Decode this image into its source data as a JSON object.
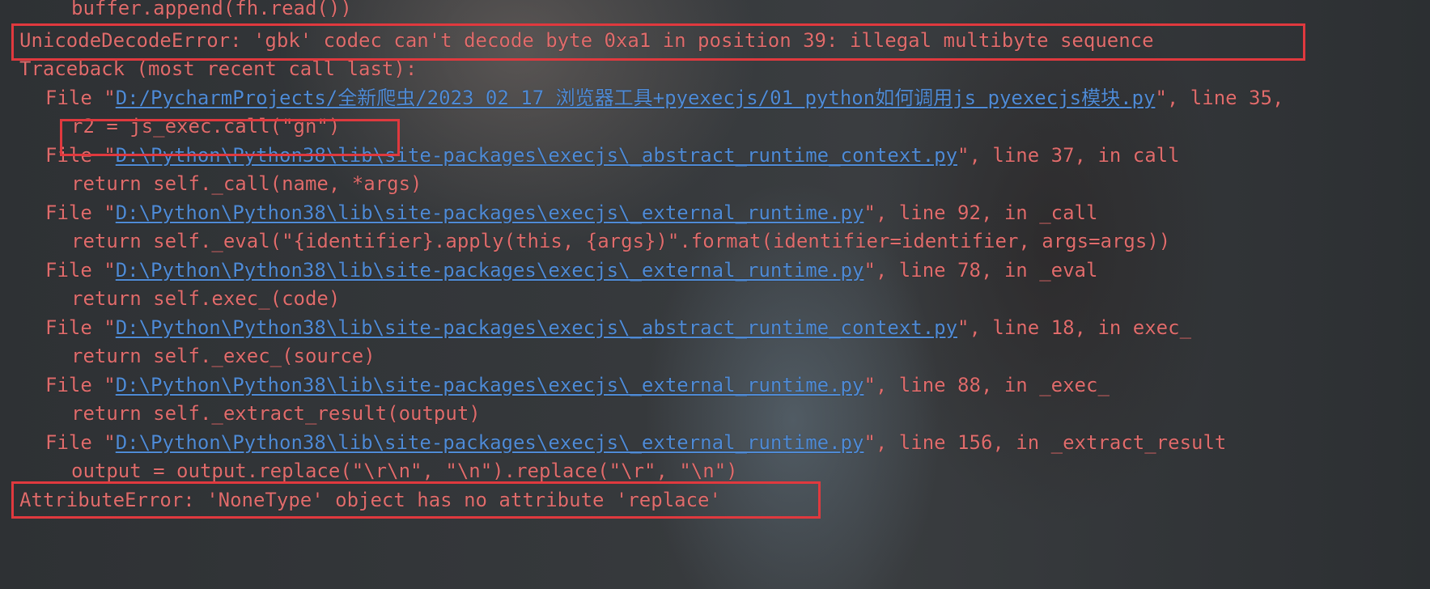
{
  "colors": {
    "error_text": "#e06c6c",
    "link": "#4f8bd6",
    "highlight_box": "#e0393e"
  },
  "lines": [
    {
      "kind": "code",
      "text": "buffer.append(fh.read())"
    },
    {
      "kind": "error",
      "text": "UnicodeDecodeError: 'gbk' codec can't decode byte 0xa1 in position 39: illegal multibyte sequence"
    },
    {
      "kind": "header",
      "text": "Traceback (most recent call last):"
    },
    {
      "kind": "file",
      "prefix": "File \"",
      "path": "D:/PycharmProjects/全新爬虫/2023 02 17 浏览器工具+pyexecjs/01 python如何调用js pyexecjs模块.py",
      "suffix": "\", line 35,"
    },
    {
      "kind": "code",
      "text": "r2 = js_exec.call(\"gn\")"
    },
    {
      "kind": "file",
      "prefix": "File \"",
      "path": "D:\\Python\\Python38\\lib\\site-packages\\execjs\\_abstract_runtime_context.py",
      "suffix": "\", line 37, in call"
    },
    {
      "kind": "code",
      "text": "return self._call(name, *args)"
    },
    {
      "kind": "file",
      "prefix": "File \"",
      "path": "D:\\Python\\Python38\\lib\\site-packages\\execjs\\_external_runtime.py",
      "suffix": "\", line 92, in _call"
    },
    {
      "kind": "code",
      "text": "return self._eval(\"{identifier}.apply(this, {args})\".format(identifier=identifier, args=args))"
    },
    {
      "kind": "file",
      "prefix": "File \"",
      "path": "D:\\Python\\Python38\\lib\\site-packages\\execjs\\_external_runtime.py",
      "suffix": "\", line 78, in _eval"
    },
    {
      "kind": "code",
      "text": "return self.exec_(code)"
    },
    {
      "kind": "file",
      "prefix": "File \"",
      "path": "D:\\Python\\Python38\\lib\\site-packages\\execjs\\_abstract_runtime_context.py",
      "suffix": "\", line 18, in exec_"
    },
    {
      "kind": "code",
      "text": "return self._exec_(source)"
    },
    {
      "kind": "file",
      "prefix": "File \"",
      "path": "D:\\Python\\Python38\\lib\\site-packages\\execjs\\_external_runtime.py",
      "suffix": "\", line 88, in _exec_"
    },
    {
      "kind": "code",
      "text": "return self._extract_result(output)"
    },
    {
      "kind": "file",
      "prefix": "File \"",
      "path": "D:\\Python\\Python38\\lib\\site-packages\\execjs\\_external_runtime.py",
      "suffix": "\", line 156, in _extract_result"
    },
    {
      "kind": "code",
      "text": "output = output.replace(\"\\r\\n\", \"\\n\").replace(\"\\r\", \"\\n\")"
    },
    {
      "kind": "error",
      "text": "AttributeError: 'NoneType' object has no attribute 'replace'"
    }
  ]
}
